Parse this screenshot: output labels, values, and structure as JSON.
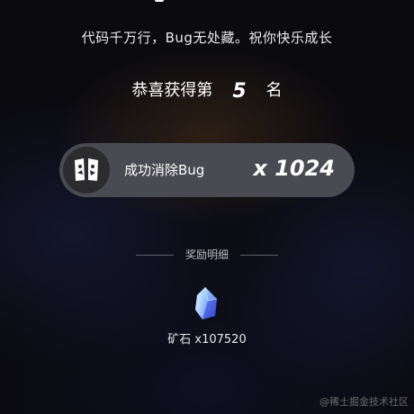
{
  "slogan": "代码千万行，Bug无处藏。祝你快乐成长",
  "rank": {
    "prefix": "恭喜获得第",
    "number": "5",
    "suffix": "名"
  },
  "achievement": {
    "badge_icon": "bug-badge-icon",
    "label": "成功消除Bug",
    "count": "x 1024"
  },
  "rewards": {
    "title": "奖励明细",
    "items": [
      {
        "icon": "mineral-crystal-icon",
        "text": "矿石 x107520"
      }
    ]
  },
  "watermark": "@稀土掘金技术社区",
  "colors": {
    "background": "#0a0a0f",
    "pill": "#4a4a52",
    "badge": "#2b2b30",
    "crystal_top": "#9fd0ff",
    "crystal_bottom": "#4a5cff"
  }
}
